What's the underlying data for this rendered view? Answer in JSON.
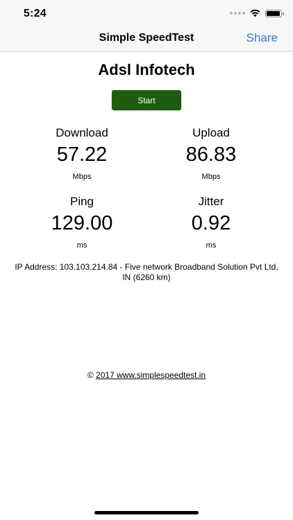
{
  "status_bar": {
    "time": "5:24",
    "icons": [
      "signal-icon",
      "wifi-icon",
      "battery-icon"
    ]
  },
  "nav": {
    "title": "Simple SpeedTest",
    "share_label": "Share"
  },
  "isp_name": "Adsl Infotech",
  "start_label": "Start",
  "metrics": {
    "download": {
      "label": "Download",
      "value": "57.22",
      "unit": "Mbps"
    },
    "upload": {
      "label": "Upload",
      "value": "86.83",
      "unit": "Mbps"
    },
    "ping": {
      "label": "Ping",
      "value": "129.00",
      "unit": "ms"
    },
    "jitter": {
      "label": "Jitter",
      "value": "0.92",
      "unit": "ms"
    }
  },
  "ip_info": {
    "line1": "IP Address: 103.103.214.84 - Five network Broadband Solution Pvt Ltd,",
    "line2": "IN (6260 km)"
  },
  "footer": {
    "copyright_symbol": "©",
    "link_text": "2017 www.simplespeedtest.in"
  },
  "colors": {
    "accent": "#2f7cc9",
    "start_button": "#1e5c10",
    "bar_background": "#f7f7f7"
  }
}
